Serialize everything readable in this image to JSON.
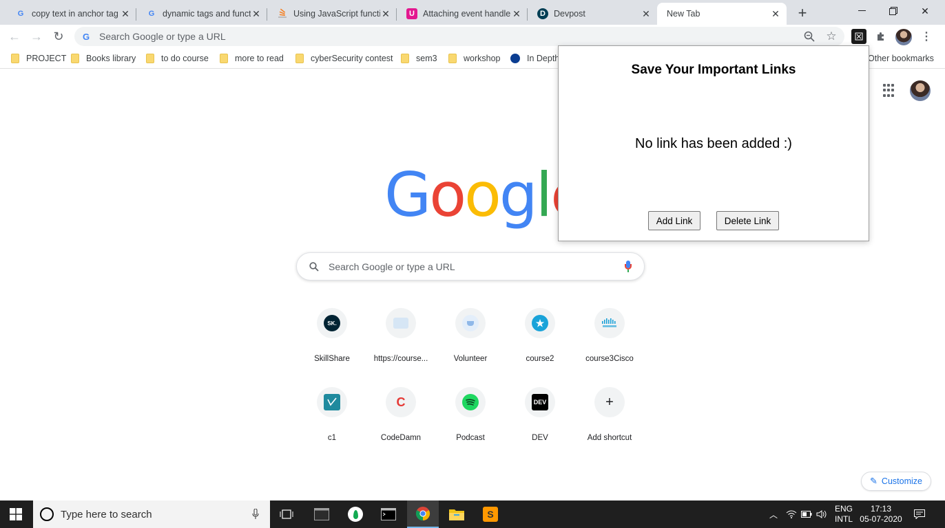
{
  "tabs": [
    {
      "title": "copy text in anchor tag",
      "favicon": "google-icon"
    },
    {
      "title": "dynamic tags and funct",
      "favicon": "google-icon"
    },
    {
      "title": "Using JavaScript functio",
      "favicon": "stackoverflow-icon"
    },
    {
      "title": "Attaching event handler",
      "favicon": "u-icon"
    },
    {
      "title": "Devpost",
      "favicon": "devpost-icon"
    },
    {
      "title": "New Tab",
      "favicon": "none",
      "active": true
    }
  ],
  "omnibox": {
    "placeholder": "Search Google or type a URL"
  },
  "bookmarks": [
    "PROJECT",
    "Books library",
    "to do course",
    "more to read",
    "cyberSecurity contest",
    "sem3",
    "workshop",
    "In Depth"
  ],
  "other_bookmarks": "Other bookmarks",
  "ntp": {
    "search_placeholder": "Search Google or type a URL",
    "shortcuts": [
      {
        "label": "SkillShare",
        "icon": "SK."
      },
      {
        "label": "https://course...",
        "icon": "course-icon"
      },
      {
        "label": "Volunteer",
        "icon": "cup-icon"
      },
      {
        "label": "course2",
        "icon": "star-icon"
      },
      {
        "label": "course3Cisco",
        "icon": "cisco-icon"
      },
      {
        "label": "c1",
        "icon": "chart-icon"
      },
      {
        "label": "CodeDamn",
        "icon": "C"
      },
      {
        "label": "Podcast",
        "icon": "spotify-icon"
      },
      {
        "label": "DEV",
        "icon": "DEV"
      },
      {
        "label": "Add shortcut",
        "icon": "+"
      }
    ],
    "customize": "Customize"
  },
  "popup": {
    "title": "Save Your Important Links",
    "message": "No link has been added :)",
    "add_button": "Add Link",
    "delete_button": "Delete Link"
  },
  "taskbar": {
    "search_placeholder": "Type here to search",
    "lang_top": "ENG",
    "lang_bottom": "INTL",
    "time": "17:13",
    "date": "05-07-2020"
  },
  "colors": {
    "accent": "#1a73e8",
    "tabstrip": "#dee1e6",
    "taskbar": "#1f1f1f"
  }
}
